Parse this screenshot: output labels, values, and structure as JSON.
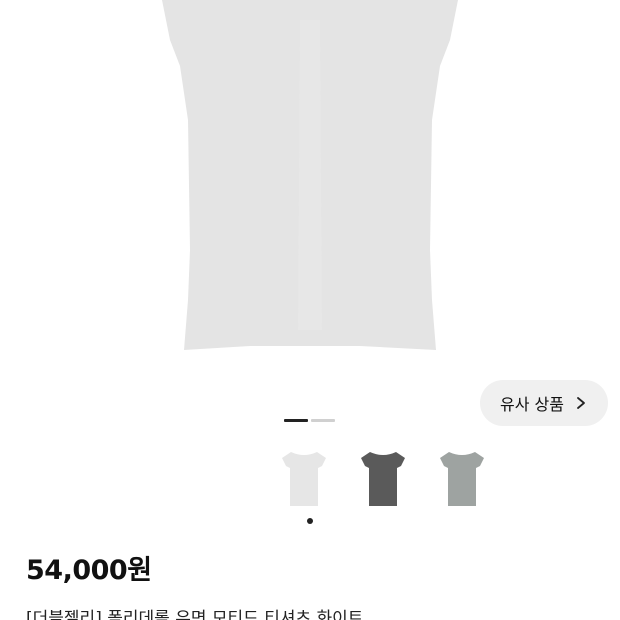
{
  "product": {
    "similar_button_label": "유사 상품",
    "price": "54,000원",
    "title": "[더블젤리] 폴리데롤 우면 모티드 티셔츠 화이트"
  },
  "gallery": {
    "image_count": 2,
    "active_index": 0,
    "shirt_color": "#e4e4e4"
  },
  "color_options": [
    {
      "name": "white",
      "color": "#e6e6e6"
    },
    {
      "name": "charcoal",
      "color": "#5a5a5a"
    },
    {
      "name": "gray",
      "color": "#9ea3a1"
    }
  ],
  "selected_color_index": 0
}
